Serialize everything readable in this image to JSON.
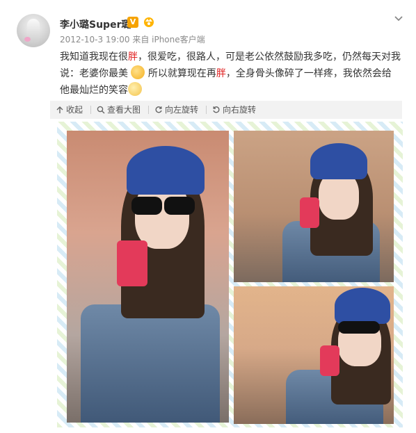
{
  "user": {
    "name": "李小璐Super璐",
    "verified_badge": "V",
    "meta": "2012-10-3 19:00 来自 iPhone客户端"
  },
  "post": {
    "seg1": "我知道我现在很",
    "red1": "胖",
    "seg2": "，很爱吃，很路人，可是老公依然鼓励我多吃，仍然每天对我说：老婆你最美",
    "seg3": "所以就算现在再",
    "red2": "胖",
    "seg4": "，全身骨头像碎了一样疼，我依然会给他最灿烂的笑容"
  },
  "toolbar": {
    "collapse": "收起",
    "view_large": "查看大图",
    "rotate_left": "向左旋转",
    "rotate_right": "向右旋转"
  },
  "colors": {
    "accent_red": "#e02020",
    "hat_blue": "#2e4fa3",
    "phone_pink": "#e33a5a"
  },
  "icons": {
    "collapse": "arrow-up-icon",
    "view_large": "magnifier-icon",
    "rotate_left": "rotate-left-icon",
    "rotate_right": "rotate-right-icon",
    "menu": "chevron-down-icon"
  }
}
